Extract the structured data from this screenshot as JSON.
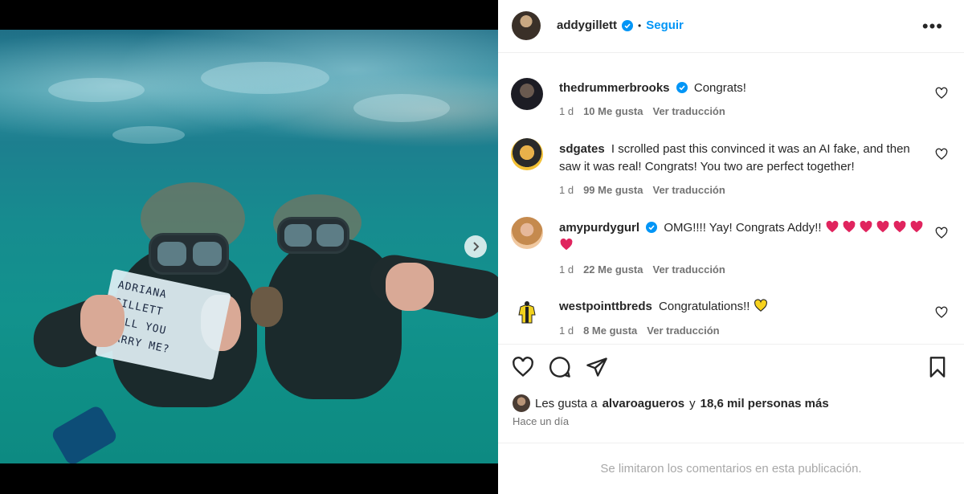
{
  "post": {
    "author": "addygillett",
    "follow_label": "Seguir",
    "sign_lines": [
      "ADRIANA GILLETT",
      "WILL YOU",
      "MARRY ME?"
    ],
    "carousel_count": 2,
    "carousel_index": 0
  },
  "comments": [
    {
      "user": "thedrummerbrooks",
      "verified": true,
      "text": "Congrats!",
      "time": "1 d",
      "likes": "10 Me gusta",
      "translate": "Ver traducción"
    },
    {
      "user": "sdgates",
      "verified": false,
      "text": "I scrolled past this convinced it was an AI fake, and then saw it was real! Congrats! You two are perfect together!",
      "time": "1 d",
      "likes": "99 Me gusta",
      "translate": "Ver traducción"
    },
    {
      "user": "amypurdygurl",
      "verified": true,
      "text": "OMG!!!! Yay! Congrats Addy!!",
      "hearts": 7,
      "time": "1 d",
      "likes": "22 Me gusta",
      "translate": "Ver traducción"
    },
    {
      "user": "westpointtbreds",
      "verified": false,
      "text": "Congratulations!!",
      "time": "1 d",
      "likes": "8 Me gusta",
      "translate": "Ver traducción"
    }
  ],
  "likes": {
    "prefix": "Les gusta a",
    "user": "alvaroagueros",
    "middle": "y",
    "others": "18,6 mil personas más"
  },
  "timestamp": "Hace un día",
  "comments_limited": "Se limitaron los comentarios en esta publicación.",
  "colors": {
    "accent": "#0095f6",
    "verified": "#0095f6",
    "heart_red": "#e0245e",
    "heart_yellow": "#f7d21e"
  }
}
